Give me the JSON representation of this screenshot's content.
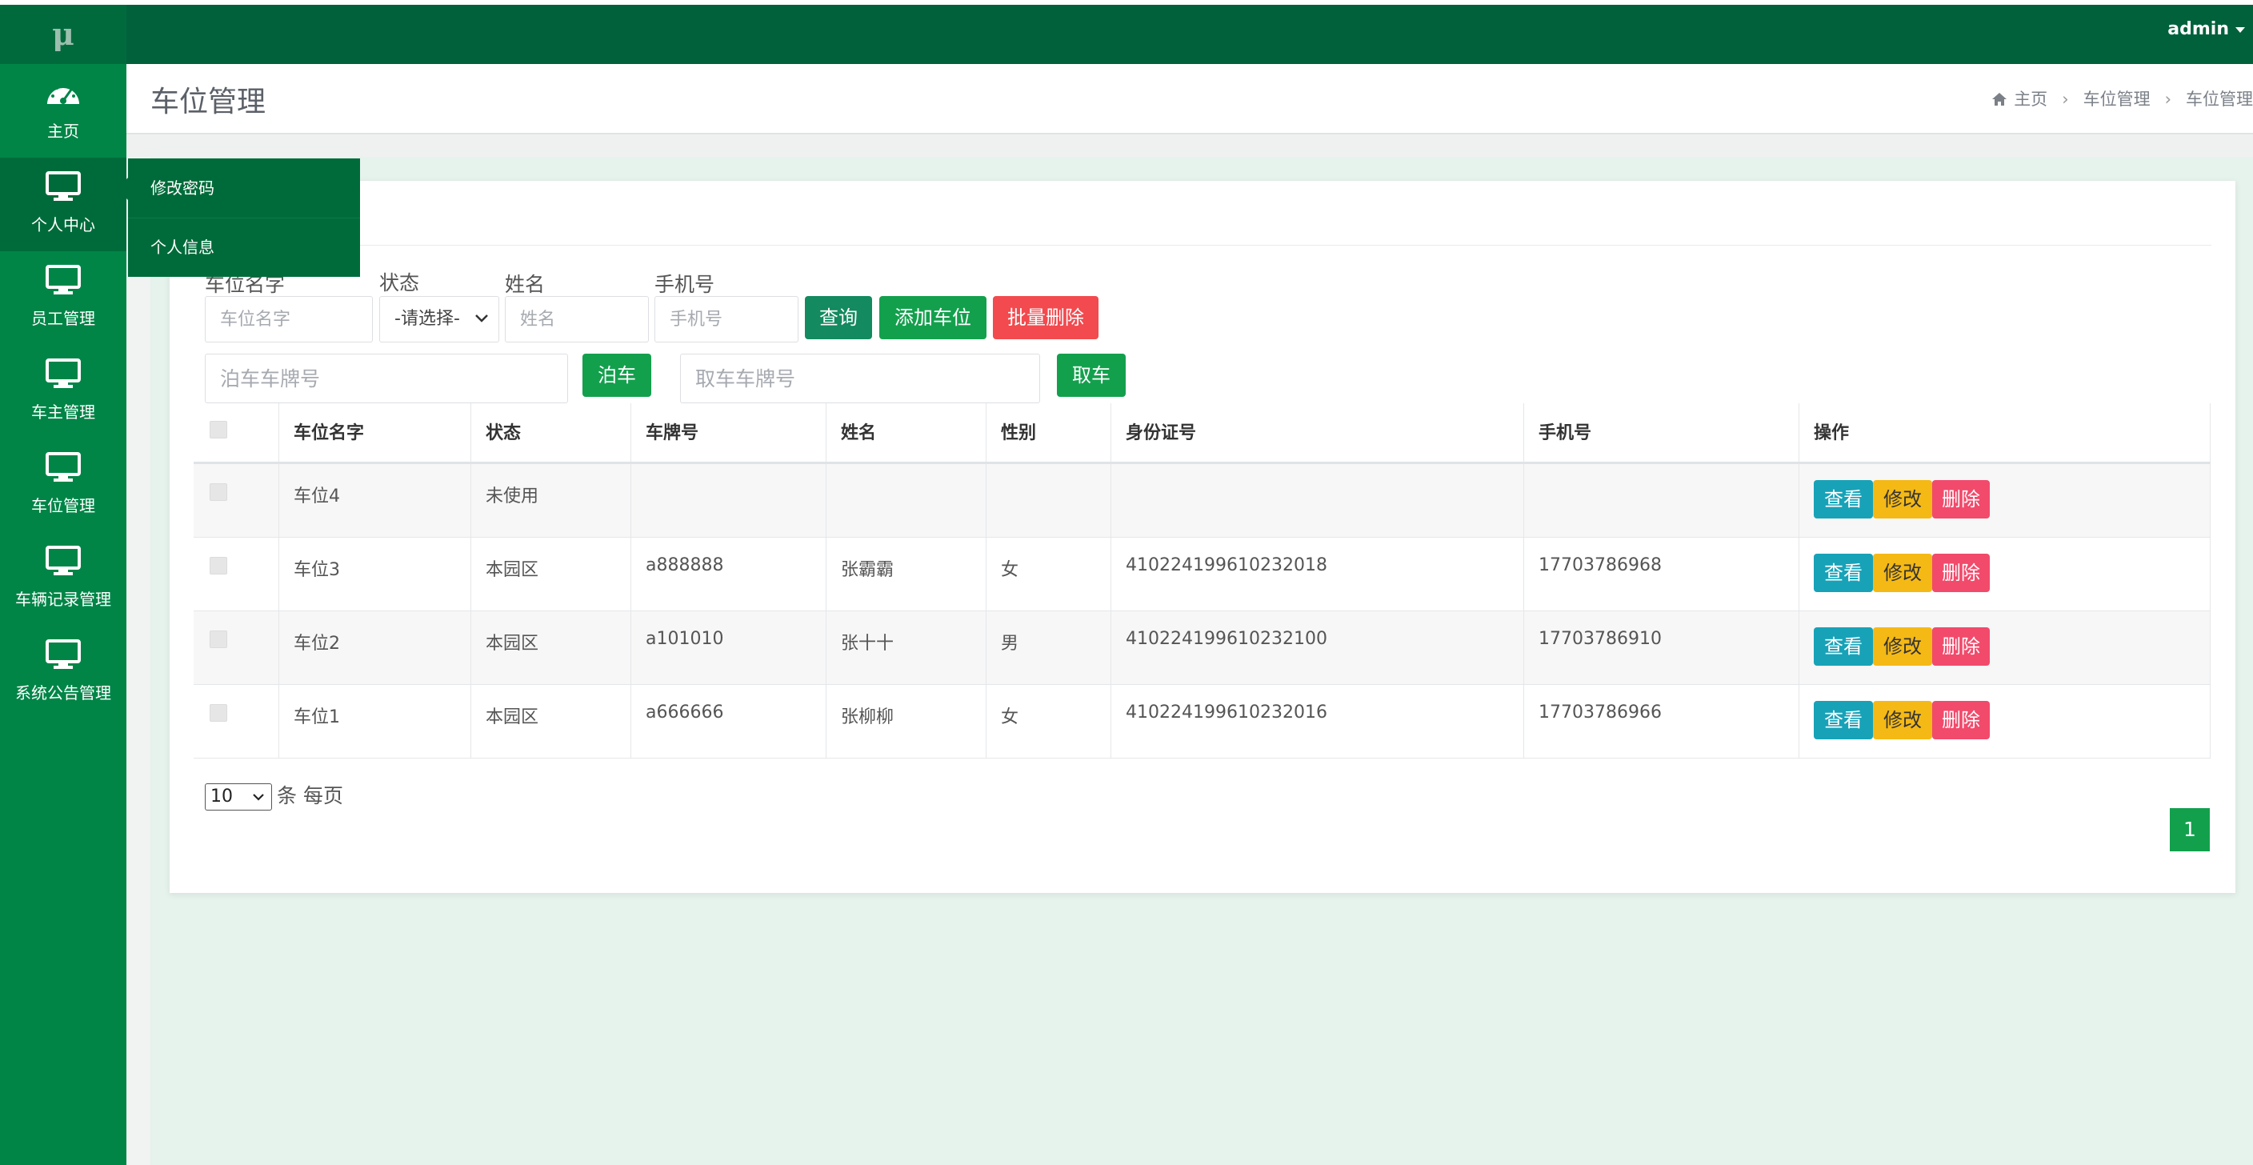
{
  "logo": "μ",
  "header": {
    "user": "admin"
  },
  "sidebar": {
    "items": [
      {
        "label": "主页",
        "icon": "dashboard-icon"
      },
      {
        "label": "个人中心",
        "icon": "monitor-icon"
      },
      {
        "label": "员工管理",
        "icon": "monitor-icon"
      },
      {
        "label": "车主管理",
        "icon": "monitor-icon"
      },
      {
        "label": "车位管理",
        "icon": "monitor-icon"
      },
      {
        "label": "车辆记录管理",
        "icon": "monitor-icon"
      },
      {
        "label": "系统公告管理",
        "icon": "monitor-icon"
      }
    ],
    "submenu": [
      {
        "label": "修改密码"
      },
      {
        "label": "个人信息"
      }
    ]
  },
  "page": {
    "title": "车位管理",
    "breadcrumb": [
      "主页",
      "车位管理",
      "车位管理"
    ]
  },
  "filters": {
    "name_label": "车位名字",
    "name_placeholder": "车位名字",
    "status_label": "状态",
    "status_value": "-请选择-",
    "person_label": "姓名",
    "person_placeholder": "姓名",
    "phone_label": "手机号",
    "phone_placeholder": "手机号",
    "query_button": "查询",
    "add_button": "添加车位",
    "batch_delete_button": "批量删除",
    "park_placeholder": "泊车车牌号",
    "park_button": "泊车",
    "pickup_placeholder": "取车车牌号",
    "pickup_button": "取车"
  },
  "table": {
    "columns": [
      "车位名字",
      "状态",
      "车牌号",
      "姓名",
      "性别",
      "身份证号",
      "手机号",
      "操作"
    ],
    "rows": [
      {
        "name": "车位4",
        "status": "未使用",
        "plate": "",
        "person": "",
        "gender": "",
        "id_card": "",
        "phone": ""
      },
      {
        "name": "车位3",
        "status": "本园区",
        "plate": "a888888",
        "person": "张霸霸",
        "gender": "女",
        "id_card": "410224199610232018",
        "phone": "17703786968"
      },
      {
        "name": "车位2",
        "status": "本园区",
        "plate": "a101010",
        "person": "张十十",
        "gender": "男",
        "id_card": "410224199610232100",
        "phone": "17703786910"
      },
      {
        "name": "车位1",
        "status": "本园区",
        "plate": "a666666",
        "person": "张柳柳",
        "gender": "女",
        "id_card": "410224199610232016",
        "phone": "17703786966"
      }
    ],
    "actions": {
      "view": "查看",
      "edit": "修改",
      "delete": "删除"
    }
  },
  "pagination": {
    "per_page": "10",
    "per_page_suffix": "条 每页",
    "current_page": "1"
  },
  "colors": {
    "sidebar": "#008547",
    "header": "#00613b",
    "primary_button": "#13a04d",
    "danger_button": "#f24a4e",
    "info_button": "#17a2b8",
    "warning_button": "#f5b915"
  }
}
